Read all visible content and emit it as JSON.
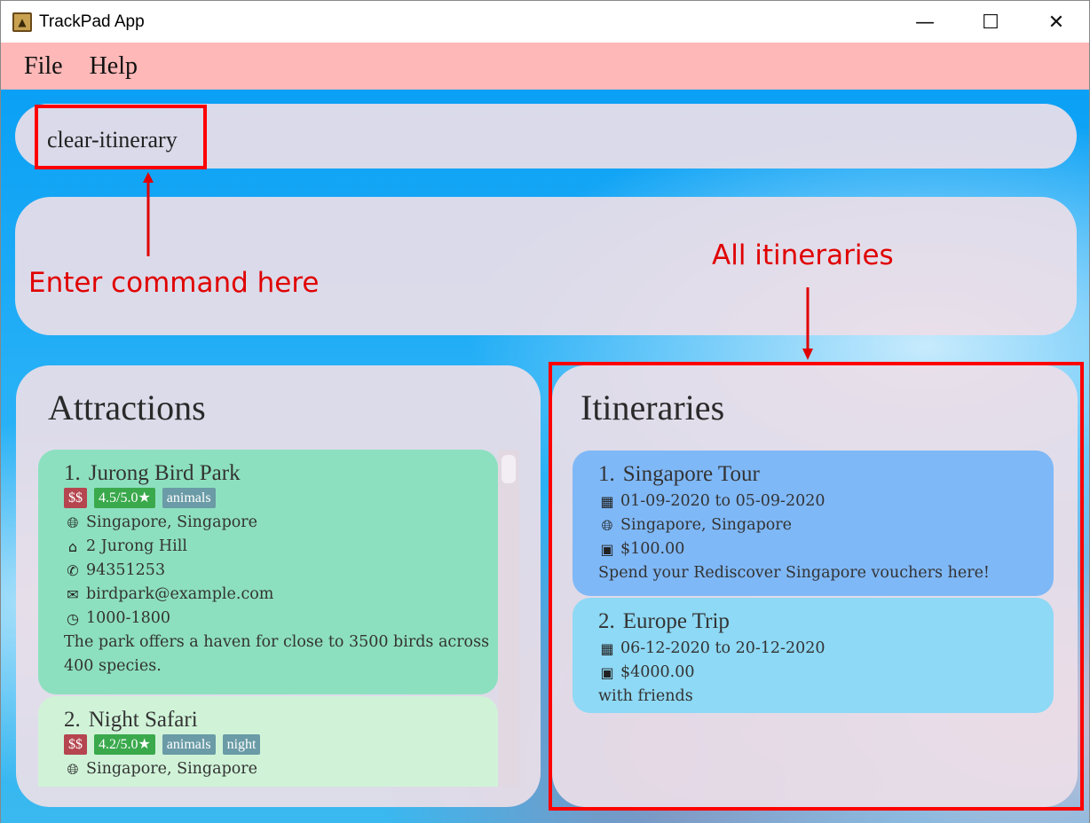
{
  "window": {
    "title": "TrackPad App",
    "minimize_glyph": "—",
    "maximize_glyph": "☐",
    "close_glyph": "✕"
  },
  "menu": {
    "file": "File",
    "help": "Help"
  },
  "command": {
    "value": "clear-itinerary"
  },
  "result": {
    "text": ""
  },
  "annotations": {
    "command_label": "Enter command here",
    "itineraries_label": "All itineraries",
    "color": "#ff0000"
  },
  "attractions": {
    "title": "Attractions",
    "items": [
      {
        "index": "1.",
        "name": "Jurong Bird Park",
        "price": "$$",
        "rating": "4.5/5.0★",
        "tags": [
          "animals"
        ],
        "location": "Singapore, Singapore",
        "address": "2 Jurong Hill",
        "phone": "94351253",
        "email": "birdpark@example.com",
        "hours": "1000-1800",
        "description": "The park offers a haven for close to 3500 birds across 400 species."
      },
      {
        "index": "2.",
        "name": "Night Safari",
        "price": "$$",
        "rating": "4.2/5.0★",
        "tags": [
          "animals",
          "night"
        ],
        "location": "Singapore, Singapore"
      }
    ]
  },
  "itineraries": {
    "title": "Itineraries",
    "items": [
      {
        "index": "1.",
        "name": "Singapore Tour",
        "dates": "01-09-2020 to 05-09-2020",
        "location": "Singapore, Singapore",
        "budget": "$100.00",
        "description": "Spend your Rediscover Singapore vouchers here!"
      },
      {
        "index": "2.",
        "name": "Europe Trip",
        "dates": "06-12-2020 to 20-12-2020",
        "budget": "$4000.00",
        "description": "with friends"
      }
    ]
  },
  "colors": {
    "menubar": "#ffb8b8",
    "attraction_card_1": "#8de0bf",
    "attraction_card_2": "#d0f3d8",
    "itinerary_card_1": "#7fb8f7",
    "itinerary_card_2": "#8ed9f5",
    "tag_price": "#b5454f",
    "tag_rating": "#3aa94c",
    "tag_label": "#6a9ba6"
  },
  "icons": {
    "app": "trackpad-app-icon",
    "globe": "globe-icon",
    "home": "home-icon",
    "phone": "phone-icon",
    "email": "email-icon",
    "clock": "clock-icon",
    "calendar": "calendar-icon",
    "money": "money-icon"
  }
}
